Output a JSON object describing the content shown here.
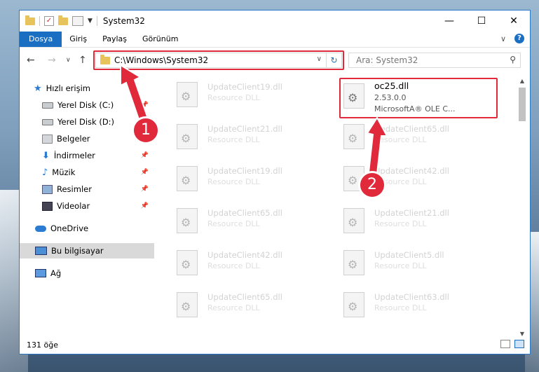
{
  "window": {
    "title": "System32"
  },
  "ribbon": {
    "tabs": [
      "Dosya",
      "Giriş",
      "Paylaş",
      "Görünüm"
    ]
  },
  "nav": {
    "address": "C:\\Windows\\System32",
    "search_placeholder": "Ara: System32"
  },
  "sidebar": {
    "items": [
      {
        "label": "Hızlı erişim"
      },
      {
        "label": "Yerel Disk (C:)"
      },
      {
        "label": "Yerel Disk (D:)"
      },
      {
        "label": "Belgeler"
      },
      {
        "label": "İndirmeler"
      },
      {
        "label": "Müzik"
      },
      {
        "label": "Resimler"
      },
      {
        "label": "Videolar"
      },
      {
        "label": "OneDrive"
      },
      {
        "label": "Bu bilgisayar"
      },
      {
        "label": "Ağ"
      }
    ]
  },
  "files": {
    "left": [
      {
        "name": "UpdateClient19.dll",
        "desc": "Resource DLL"
      },
      {
        "name": "UpdateClient21.dll",
        "desc": "Resource DLL"
      },
      {
        "name": "UpdateClient19.dll",
        "desc": "Resource DLL"
      },
      {
        "name": "UpdateClient65.dll",
        "desc": "Resource DLL"
      },
      {
        "name": "UpdateClient42.dll",
        "desc": "Resource DLL"
      },
      {
        "name": "UpdateClient65.dll",
        "desc": "Resource DLL"
      }
    ],
    "highlight": {
      "name": "oc25.dll",
      "version": "2.53.0.0",
      "company": "MicrosoftA® OLE C..."
    },
    "right": [
      {
        "name": "UpdateClient65.dll",
        "desc": "Resource DLL"
      },
      {
        "name": "UpdateClient42.dll",
        "desc": "Resource DLL"
      },
      {
        "name": "UpdateClient21.dll",
        "desc": "Resource DLL"
      },
      {
        "name": "UpdateClient5.dll",
        "desc": "Resource DLL"
      },
      {
        "name": "UpdateClient63.dll",
        "desc": "Resource DLL"
      }
    ]
  },
  "status": {
    "count": "131 öğe"
  },
  "annotations": {
    "badge1": "1",
    "badge2": "2"
  },
  "colors": {
    "accent": "#1a6fc2",
    "highlight": "#e0293a"
  }
}
